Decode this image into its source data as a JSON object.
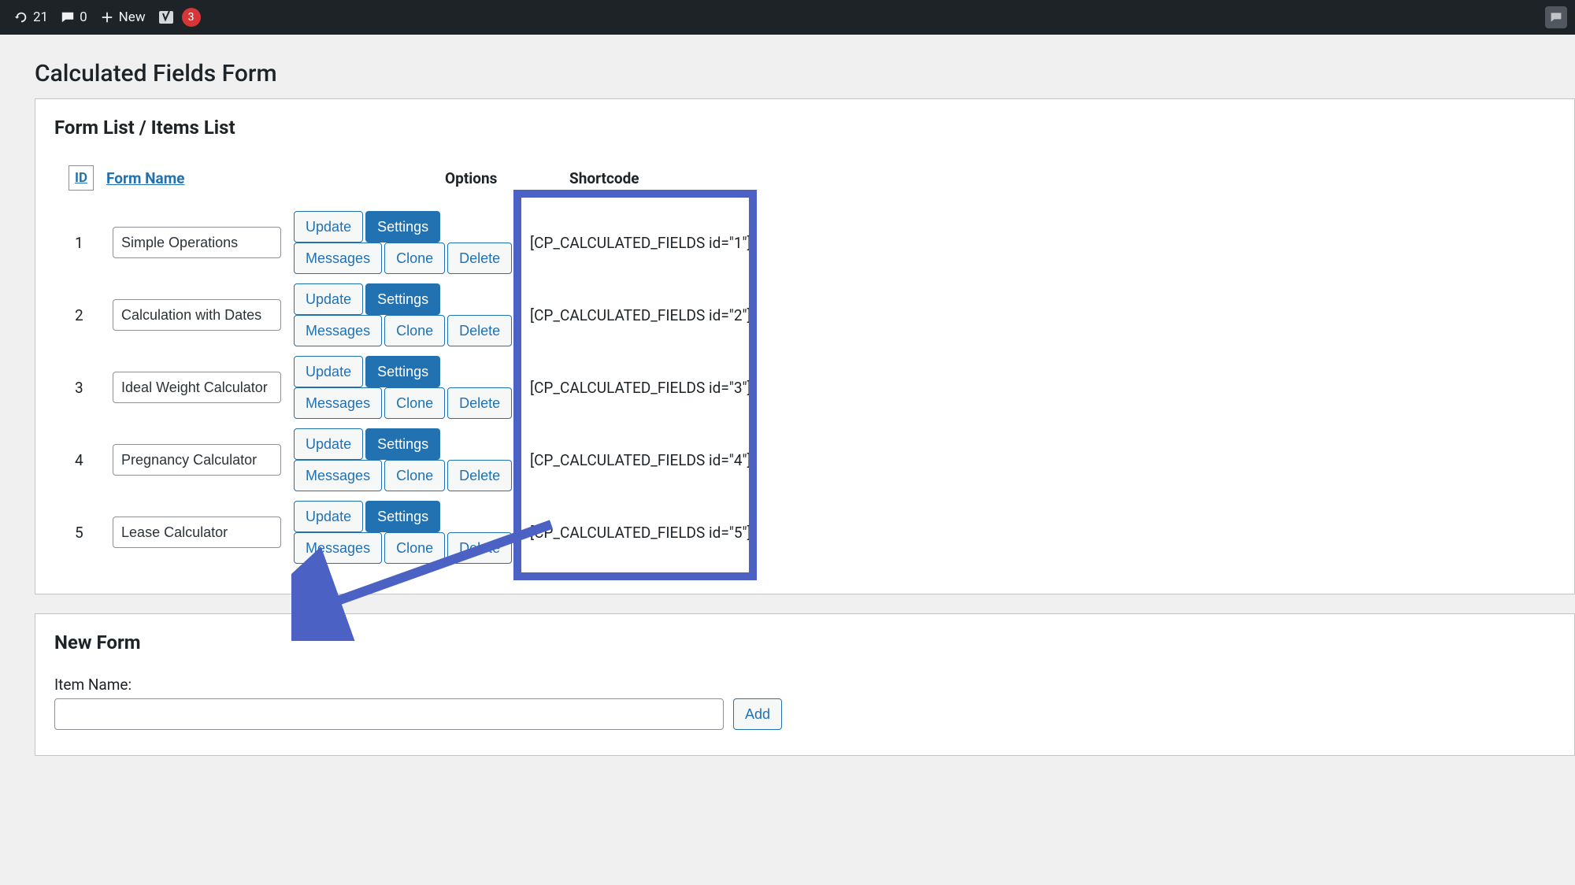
{
  "adminbar": {
    "updates_count": "21",
    "comments_count": "0",
    "new_label": "New",
    "yoast_badge": "3"
  },
  "page": {
    "title": "Calculated Fields Form"
  },
  "list_section": {
    "title": "Form List / Items List",
    "headers": {
      "id": "ID",
      "name": "Form Name",
      "options": "Options",
      "shortcode": "Shortcode"
    },
    "buttons": {
      "update": "Update",
      "settings": "Settings",
      "messages": "Messages",
      "clone": "Clone",
      "delete": "Delete"
    },
    "rows": [
      {
        "id": "1",
        "name": "Simple Operations",
        "shortcode": "[CP_CALCULATED_FIELDS id=\"1\"]"
      },
      {
        "id": "2",
        "name": "Calculation with Dates",
        "shortcode": "[CP_CALCULATED_FIELDS id=\"2\"]"
      },
      {
        "id": "3",
        "name": "Ideal Weight Calculator",
        "shortcode": "[CP_CALCULATED_FIELDS id=\"3\"]"
      },
      {
        "id": "4",
        "name": "Pregnancy Calculator",
        "shortcode": "[CP_CALCULATED_FIELDS id=\"4\"]"
      },
      {
        "id": "5",
        "name": "Lease Calculator",
        "shortcode": "[CP_CALCULATED_FIELDS id=\"5\"]"
      }
    ]
  },
  "new_form": {
    "title": "New Form",
    "label": "Item Name:",
    "add_button": "Add",
    "value": ""
  }
}
